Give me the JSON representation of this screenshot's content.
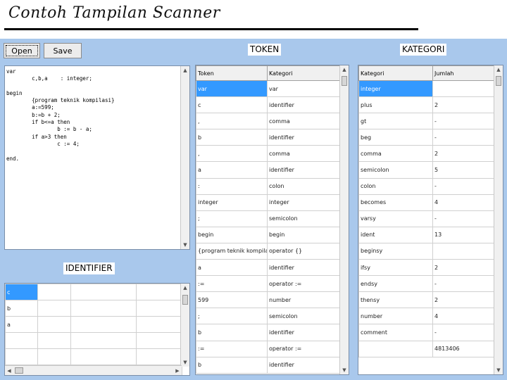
{
  "slide": {
    "title": "Contoh Tampilan Scanner"
  },
  "toolbar": {
    "open_label": "Open",
    "save_label": "Save"
  },
  "editor": {
    "code_lines": [
      "var",
      "        c,b,a    : integer;",
      "",
      "begin",
      "        {program teknik kompilasi}",
      "        a:=599;",
      "        b:=b + 2;",
      "        if b<=a then",
      "                b := b - a;",
      "        if a>3 then",
      "                c := 4;",
      "",
      "end."
    ]
  },
  "identifier": {
    "label": "IDENTIFIER",
    "rows": [
      "c",
      "b",
      "a",
      "",
      "",
      ""
    ]
  },
  "token": {
    "label": "TOKEN",
    "columns": [
      "Token",
      "Kategori"
    ],
    "rows": [
      [
        "var",
        "var"
      ],
      [
        "c",
        "identifier"
      ],
      [
        ",",
        "comma"
      ],
      [
        "b",
        "identifier"
      ],
      [
        ",",
        "comma"
      ],
      [
        "a",
        "identifier"
      ],
      [
        ":",
        "colon"
      ],
      [
        "integer",
        "integer"
      ],
      [
        ";",
        "semicolon"
      ],
      [
        "begin",
        "begin"
      ],
      [
        "{program teknik kompilasi}",
        "operator {}"
      ],
      [
        "a",
        "identifier"
      ],
      [
        ":=",
        "operator :="
      ],
      [
        "599",
        "number"
      ],
      [
        ";",
        "semicolon"
      ],
      [
        "b",
        "identifier"
      ],
      [
        ":=",
        "operator :="
      ],
      [
        "b",
        "identifier"
      ]
    ]
  },
  "kategori": {
    "label": "KATEGORI",
    "columns": [
      "Kategori",
      "Jumlah"
    ],
    "rows": [
      [
        "integer",
        ""
      ],
      [
        "plus",
        "2"
      ],
      [
        "gt",
        "-"
      ],
      [
        "beg",
        "-"
      ],
      [
        "comma",
        "2"
      ],
      [
        "semicolon",
        "5"
      ],
      [
        "colon",
        "-"
      ],
      [
        "becomes",
        "4"
      ],
      [
        "varsy",
        "-"
      ],
      [
        "ident",
        "13"
      ],
      [
        "beginsy",
        ""
      ],
      [
        "ifsy",
        "2"
      ],
      [
        "endsy",
        "-"
      ],
      [
        "thensy",
        "2"
      ],
      [
        "number",
        "4"
      ],
      [
        "comment",
        "-"
      ],
      [
        "",
        "4813406"
      ]
    ]
  }
}
